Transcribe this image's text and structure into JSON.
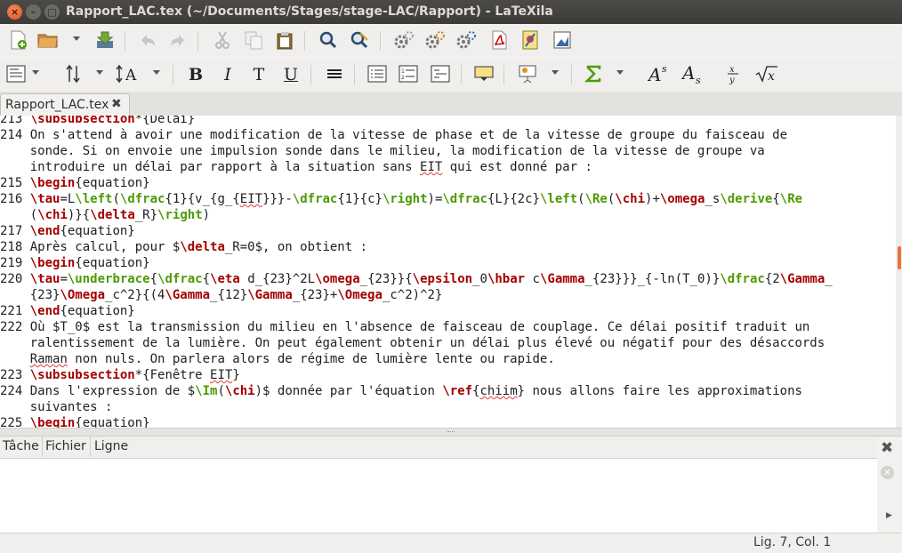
{
  "window": {
    "title": "Rapport_LAC.tex (~/Documents/Stages/stage-LAC/Rapport) - LaTeXila"
  },
  "tab": {
    "label": "Rapport_LAC.tex"
  },
  "format_labels": {
    "bold": "B",
    "italic": "I",
    "typewriter": "T",
    "underline": "U"
  },
  "editor": {
    "lines": [
      {
        "n": "213",
        "parts": [
          {
            "t": "\\subsubsection",
            "c": "cmd"
          },
          {
            "t": "*{Délai}"
          }
        ]
      },
      {
        "n": "214",
        "parts": [
          {
            "t": "On s'attend à avoir une modification de la vitesse de phase et de la vitesse de groupe du faisceau de"
          }
        ]
      },
      {
        "n": "",
        "parts": [
          {
            "t": "sonde. Si on envoie une impulsion sonde dans le milieu, la modification de la vitesse de groupe va"
          }
        ]
      },
      {
        "n": "",
        "parts": [
          {
            "t": "introduire un délai par rapport à la situation sans "
          },
          {
            "t": "EIT",
            "c": "sp"
          },
          {
            "t": " qui est donné par :"
          }
        ]
      },
      {
        "n": "215",
        "parts": [
          {
            "t": "\\begin",
            "c": "cmd"
          },
          {
            "t": "{equation}"
          }
        ]
      },
      {
        "n": "216",
        "parts": [
          {
            "t": "\\tau",
            "c": "cmd"
          },
          {
            "t": "=L"
          },
          {
            "t": "\\left",
            "c": "cmd2"
          },
          {
            "t": "("
          },
          {
            "t": "\\dfrac",
            "c": "cmd2"
          },
          {
            "t": "{1}{v_{g_{"
          },
          {
            "t": "EIT",
            "c": "sp"
          },
          {
            "t": "}}}-"
          },
          {
            "t": "\\dfrac",
            "c": "cmd2"
          },
          {
            "t": "{1}{c}"
          },
          {
            "t": "\\right",
            "c": "cmd2"
          },
          {
            "t": ")="
          },
          {
            "t": "\\dfrac",
            "c": "cmd2"
          },
          {
            "t": "{L}{2c}"
          },
          {
            "t": "\\left",
            "c": "cmd2"
          },
          {
            "t": "("
          },
          {
            "t": "\\Re",
            "c": "cmd2"
          },
          {
            "t": "("
          },
          {
            "t": "\\chi",
            "c": "cmd"
          },
          {
            "t": ")+"
          },
          {
            "t": "\\omega",
            "c": "cmd"
          },
          {
            "t": "_s"
          },
          {
            "t": "\\derive",
            "c": "cmd2"
          },
          {
            "t": "{"
          },
          {
            "t": "\\Re",
            "c": "cmd2"
          }
        ]
      },
      {
        "n": "",
        "parts": [
          {
            "t": "("
          },
          {
            "t": "\\chi",
            "c": "cmd"
          },
          {
            "t": ")}{"
          },
          {
            "t": "\\delta",
            "c": "cmd"
          },
          {
            "t": "_R}"
          },
          {
            "t": "\\right",
            "c": "cmd2"
          },
          {
            "t": ")"
          }
        ]
      },
      {
        "n": "217",
        "parts": [
          {
            "t": "\\end",
            "c": "cmd"
          },
          {
            "t": "{equation}"
          }
        ]
      },
      {
        "n": "218",
        "parts": [
          {
            "t": "Après calcul, pour $"
          },
          {
            "t": "\\delta",
            "c": "cmd"
          },
          {
            "t": "_R=0$, on obtient :"
          }
        ]
      },
      {
        "n": "219",
        "parts": [
          {
            "t": "\\begin",
            "c": "cmd"
          },
          {
            "t": "{equation}"
          }
        ]
      },
      {
        "n": "220",
        "parts": [
          {
            "t": "\\tau",
            "c": "cmd"
          },
          {
            "t": "="
          },
          {
            "t": "\\underbrace",
            "c": "cmd2"
          },
          {
            "t": "{"
          },
          {
            "t": "\\dfrac",
            "c": "cmd2"
          },
          {
            "t": "{"
          },
          {
            "t": "\\eta",
            "c": "cmd"
          },
          {
            "t": " d_{23}^2L"
          },
          {
            "t": "\\omega",
            "c": "cmd"
          },
          {
            "t": "_{23}}{"
          },
          {
            "t": "\\epsilon",
            "c": "cmd"
          },
          {
            "t": "_0"
          },
          {
            "t": "\\hbar",
            "c": "cmd"
          },
          {
            "t": " c"
          },
          {
            "t": "\\Gamma",
            "c": "cmd"
          },
          {
            "t": "_{23}}}_{-ln(T_0)}"
          },
          {
            "t": "\\dfrac",
            "c": "cmd2"
          },
          {
            "t": "{2"
          },
          {
            "t": "\\Gamma",
            "c": "cmd"
          },
          {
            "t": "_"
          }
        ]
      },
      {
        "n": "",
        "parts": [
          {
            "t": "{23}"
          },
          {
            "t": "\\Omega",
            "c": "cmd"
          },
          {
            "t": "_c^2}{(4"
          },
          {
            "t": "\\Gamma",
            "c": "cmd"
          },
          {
            "t": "_{12}"
          },
          {
            "t": "\\Gamma",
            "c": "cmd"
          },
          {
            "t": "_{23}+"
          },
          {
            "t": "\\Omega",
            "c": "cmd"
          },
          {
            "t": "_c^2)^2}"
          }
        ]
      },
      {
        "n": "221",
        "parts": [
          {
            "t": "\\end",
            "c": "cmd"
          },
          {
            "t": "{equation}"
          }
        ]
      },
      {
        "n": "222",
        "parts": [
          {
            "t": "Où $T_0$ est la transmission du milieu en l'absence de faisceau de couplage. Ce délai positif traduit un"
          }
        ]
      },
      {
        "n": "",
        "parts": [
          {
            "t": "ralentissement de la lumière. On peut également obtenir un délai plus élevé ou négatif pour des désaccords"
          }
        ]
      },
      {
        "n": "",
        "parts": [
          {
            "t": "Raman",
            "c": "sp"
          },
          {
            "t": " non nuls. On parlera alors de régime de lumière lente ou rapide."
          }
        ]
      },
      {
        "n": "223",
        "parts": [
          {
            "t": "\\subsubsection",
            "c": "cmd"
          },
          {
            "t": "*{Fenêtre "
          },
          {
            "t": "EIT",
            "c": "sp"
          },
          {
            "t": "}"
          }
        ]
      },
      {
        "n": "224",
        "parts": [
          {
            "t": "Dans l'expression de $"
          },
          {
            "t": "\\Im",
            "c": "cmd2"
          },
          {
            "t": "("
          },
          {
            "t": "\\chi",
            "c": "cmd"
          },
          {
            "t": ")$ donnée par l'équation "
          },
          {
            "t": "\\ref",
            "c": "cmd"
          },
          {
            "t": "{"
          },
          {
            "t": "chiim",
            "c": "sp"
          },
          {
            "t": "} nous allons faire les approximations"
          }
        ]
      },
      {
        "n": "",
        "parts": [
          {
            "t": "suivantes :"
          }
        ]
      },
      {
        "n": "225",
        "parts": [
          {
            "t": "\\begin",
            "c": "cmd"
          },
          {
            "t": "{equation}"
          }
        ]
      }
    ]
  },
  "bottom_tabs": [
    "Tâche",
    "Fichier",
    "Ligne"
  ],
  "statusbar": {
    "position": "Lig. 7, Col. 1"
  },
  "colors": {
    "accent": "#e9743b",
    "command": "#a40000",
    "command_alt": "#4e9a06"
  }
}
